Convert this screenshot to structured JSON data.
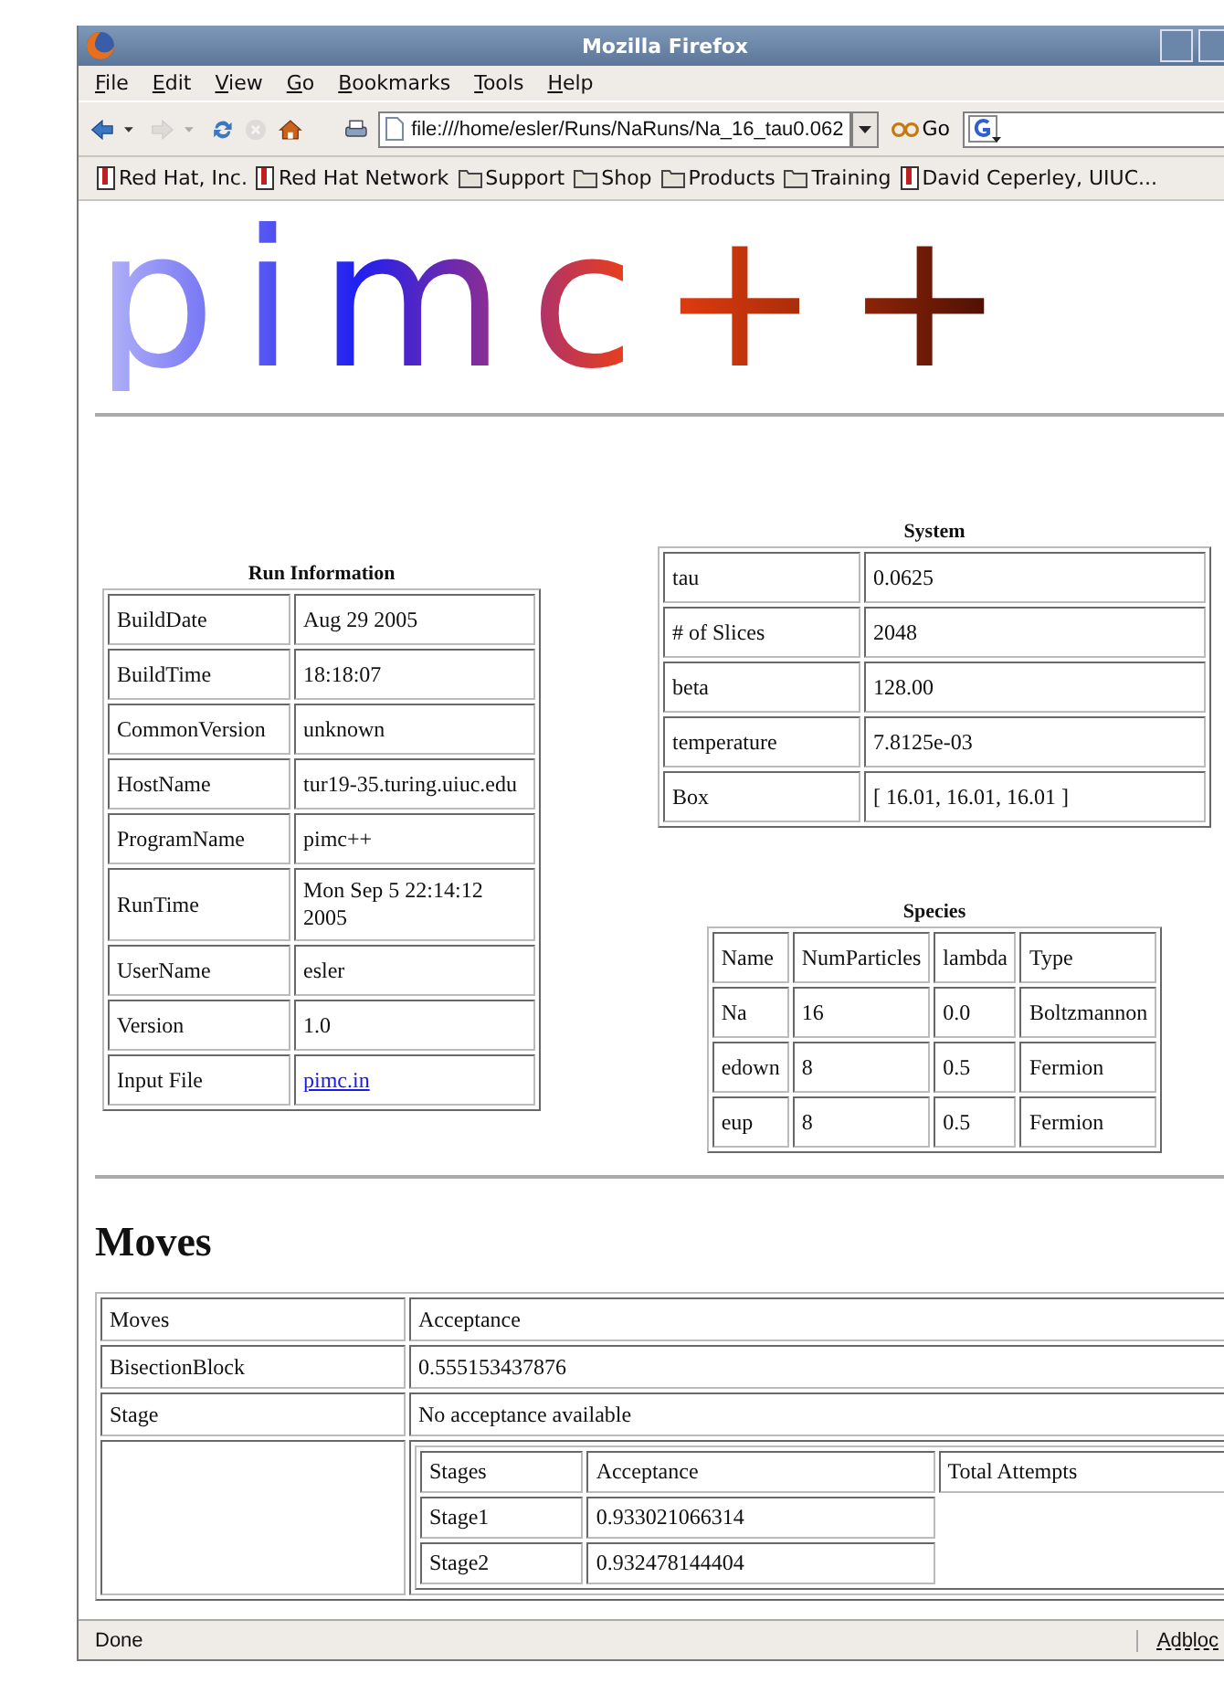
{
  "window": {
    "title": "Mozilla Firefox"
  },
  "menu": [
    {
      "label": "File"
    },
    {
      "label": "Edit"
    },
    {
      "label": "View"
    },
    {
      "label": "Go"
    },
    {
      "label": "Bookmarks"
    },
    {
      "label": "Tools"
    },
    {
      "label": "Help"
    }
  ],
  "toolbar": {
    "buttons": [
      {
        "kind": "back",
        "disabled": false
      },
      {
        "kind": "forward",
        "disabled": true
      },
      {
        "kind": "reload",
        "disabled": false
      },
      {
        "kind": "stop",
        "disabled": true
      },
      {
        "kind": "home",
        "disabled": false
      },
      {
        "kind": "print",
        "disabled": false
      }
    ],
    "address": {
      "value": "file:///home/esler/Runs/NaRuns/Na_16_tau0.062"
    },
    "go_label": "Go"
  },
  "bookmarks": [
    {
      "label": "Red Hat, Inc.",
      "kind": "page"
    },
    {
      "label": "Red Hat Network",
      "kind": "page"
    },
    {
      "label": "Support",
      "kind": "folder"
    },
    {
      "label": "Shop",
      "kind": "folder"
    },
    {
      "label": "Products",
      "kind": "folder"
    },
    {
      "label": "Training",
      "kind": "folder"
    },
    {
      "label": "David Ceperley, UIUC...",
      "kind": "page"
    }
  ],
  "page": {
    "logo": "pimc++",
    "run_info": {
      "caption": "Run Information",
      "rows": [
        {
          "key": "BuildDate",
          "value": "Aug 29 2005",
          "kind": "text"
        },
        {
          "key": "BuildTime",
          "value": "18:18:07",
          "kind": "text"
        },
        {
          "key": "CommonVersion",
          "value": "unknown",
          "kind": "text"
        },
        {
          "key": "HostName",
          "value": "tur19-35.turing.uiuc.edu",
          "kind": "text"
        },
        {
          "key": "ProgramName",
          "value": "pimc++",
          "kind": "text"
        },
        {
          "key": "RunTime",
          "value": "Mon Sep 5 22:14:12 2005",
          "kind": "text"
        },
        {
          "key": "UserName",
          "value": "esler",
          "kind": "text"
        },
        {
          "key": "Version",
          "value": "1.0",
          "kind": "text"
        },
        {
          "key": "Input File",
          "value": "pimc.in",
          "kind": "link"
        }
      ]
    },
    "system": {
      "caption": "System",
      "rows": [
        [
          "tau",
          "0.0625"
        ],
        [
          "# of Slices",
          "2048"
        ],
        [
          "beta",
          "128.00"
        ],
        [
          "temperature",
          "7.8125e-03"
        ],
        [
          "Box",
          "[ 16.01, 16.01, 16.01 ]"
        ]
      ]
    },
    "species": {
      "caption": "Species",
      "columns": [
        "Name",
        "NumParticles",
        "lambda",
        "Type"
      ],
      "rows": [
        [
          "Na",
          "16",
          "0.0",
          "Boltzmannon"
        ],
        [
          "edown",
          "8",
          "0.5",
          "Fermion"
        ],
        [
          "eup",
          "8",
          "0.5",
          "Fermion"
        ]
      ]
    },
    "moves_heading": "Moves",
    "moves": {
      "rows": [
        [
          "Moves",
          "Acceptance"
        ],
        [
          "BisectionBlock",
          "0.555153437876"
        ],
        [
          "Stage",
          "No acceptance available"
        ]
      ],
      "stages": {
        "columns": [
          "Stages",
          "Acceptance",
          "Total Attempts"
        ],
        "rows": [
          [
            "Stage1",
            "0.933021066314"
          ],
          [
            "Stage2",
            "0.932478144404"
          ]
        ]
      }
    }
  },
  "status_bar": {
    "text": "Done",
    "extension": "Adbloc"
  }
}
